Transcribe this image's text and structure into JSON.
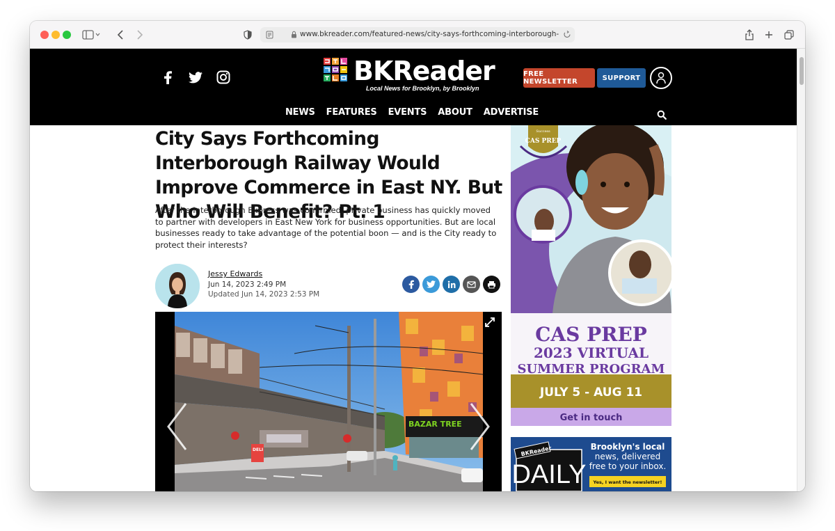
{
  "browser": {
    "url": "www.bkreader.com/featured-news/city-says-forthcoming-interborough-railway"
  },
  "site": {
    "logo_text": "BKReader",
    "logo_tagline": "Local News for Brooklyn, by Brooklyn",
    "newsletter_button": "FREE NEWSLETTER",
    "support_button": "SUPPORT",
    "nav": [
      "NEWS",
      "FEATURES",
      "EVENTS",
      "ABOUT",
      "ADVERTISE"
    ]
  },
  "article": {
    "title": "City Says Forthcoming Interborough Railway Would Improve Commerce in East NY. But Who Will Benefit? Pt. 1",
    "dek": "After the Interborough Express was confirmed, private business has quickly moved to partner with developers in East New York for business opportunities. But are local businesses ready to take advantage of the potential boon — and is the City ready to protect their interests?",
    "author": "Jessy Edwards",
    "published": "Jun 14, 2023 2:49 PM",
    "updated": "Updated Jun 14, 2023 2:53 PM",
    "photo_signs": [
      "DELI",
      "BAZAR TREE"
    ]
  },
  "ad_cas_prep": {
    "badge_top": "Success",
    "badge_name": "CAS PREP",
    "line1": "CAS PREP",
    "line2": "2023 VIRTUAL",
    "line3": "SUMMER PROGRAM",
    "dates": "JULY 5 - AUG 11",
    "cta": "Get in touch"
  },
  "ad_daily": {
    "brand": "BKReader",
    "title": "DAILY",
    "headline_1": "Brooklyn's local",
    "headline_2": "news, delivered",
    "headline_3": "free to your inbox.",
    "cta": "Yes, I want the newsletter!"
  },
  "colors": {
    "header_bg": "#000000",
    "newsletter_btn": "#c4462c",
    "support_btn": "#1f5a98",
    "ad_purple": "#6b3fa0",
    "ad_gold": "#a8912a",
    "ad_lavender": "#c9a8e8",
    "daily_blue": "#1e4b8f",
    "daily_yellow": "#f5d222"
  }
}
